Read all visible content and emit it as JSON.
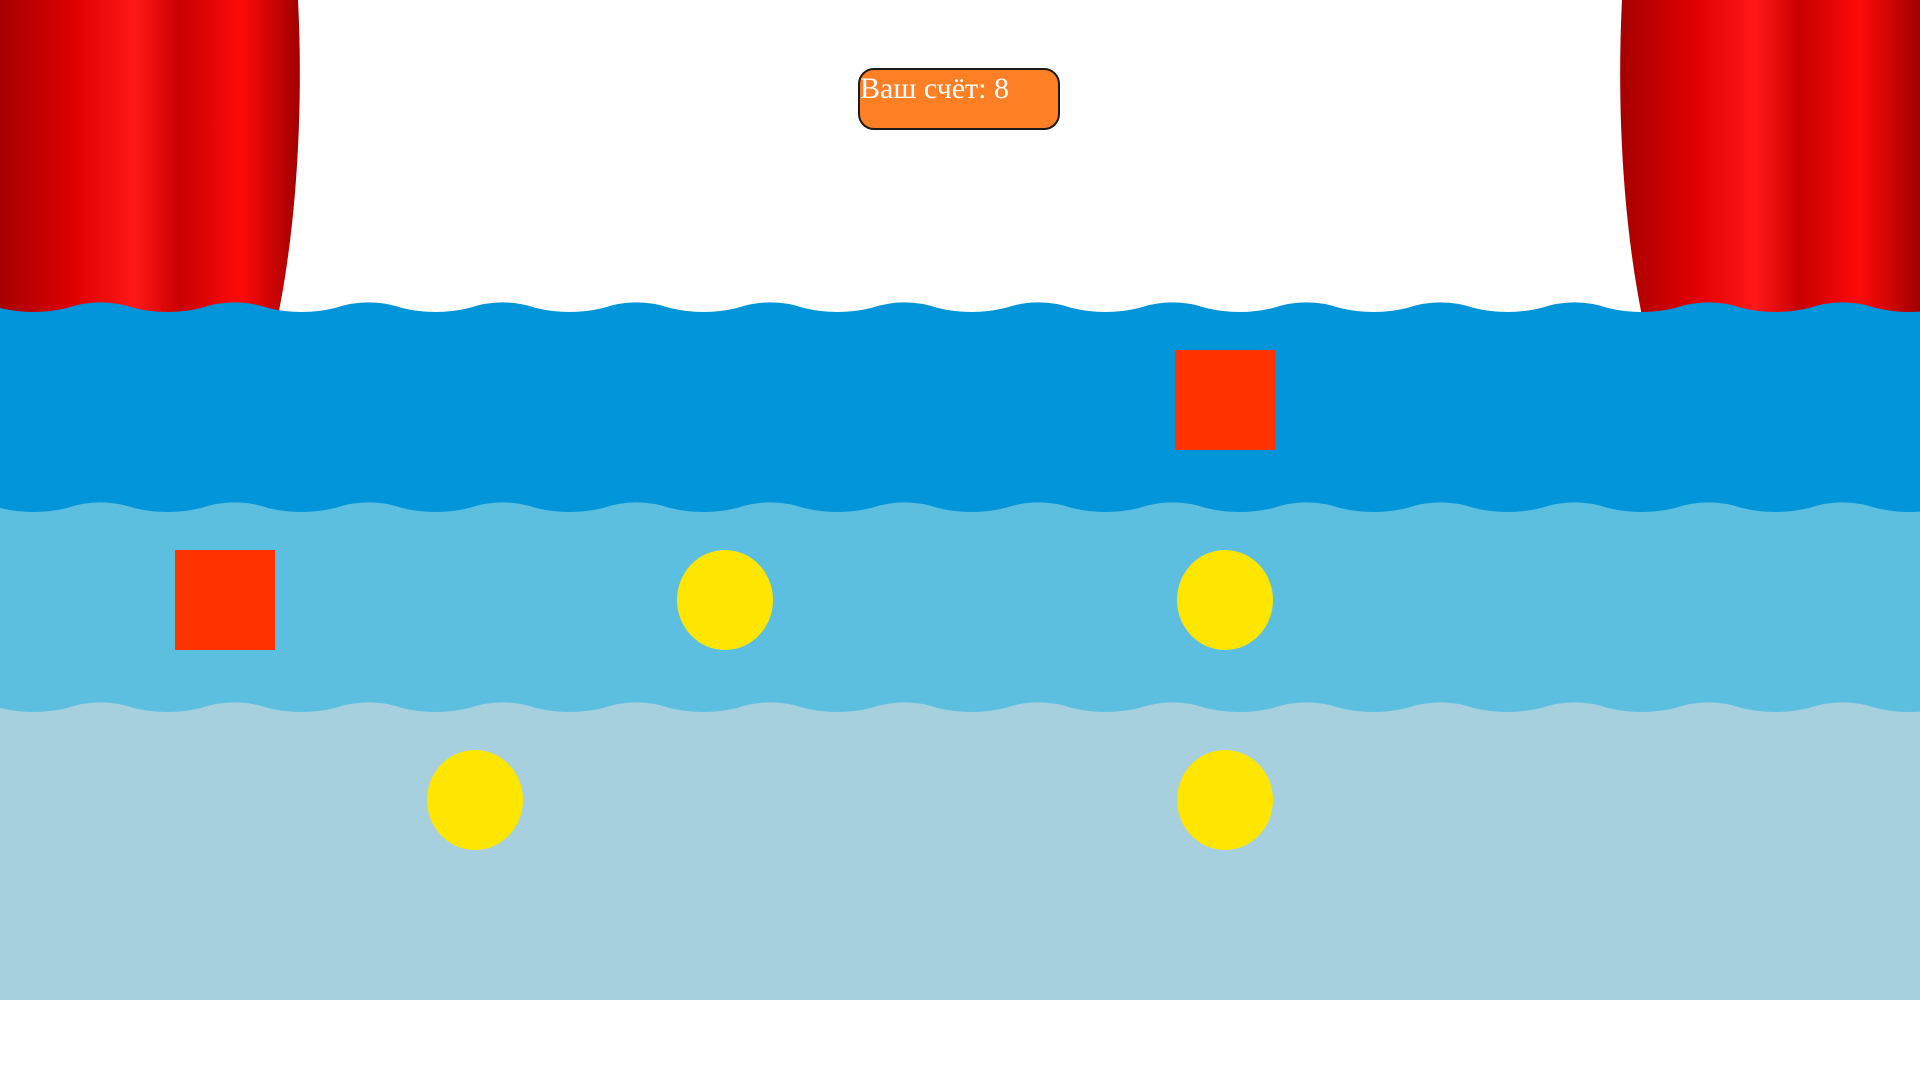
{
  "score": {
    "label": "Ваш счёт: 8",
    "background_color": "#ff7f24",
    "text_color": "#ffffff"
  },
  "colors": {
    "page_background": "#ffffff",
    "curtain_dark": "#a60000",
    "curtain_mid": "#d00000",
    "curtain_light": "#ff1010",
    "water_front": "#a7d0df",
    "water_middle": "#5cbfe0",
    "water_back": "#0295da",
    "square_target": "#ff3300",
    "circle_target": "#ffe600"
  },
  "lanes": [
    {
      "name": "back-water",
      "color": "#0295da"
    },
    {
      "name": "middle-water",
      "color": "#5cbfe0"
    },
    {
      "name": "front-water",
      "color": "#a7d0df"
    }
  ],
  "targets": [
    {
      "shape": "square",
      "lane": "back-water",
      "column": 5,
      "icon": "red-square-target"
    },
    {
      "shape": "square",
      "lane": "middle-water",
      "column": 1,
      "icon": "red-square-target"
    },
    {
      "shape": "circle",
      "lane": "middle-water",
      "column": 3,
      "icon": "yellow-circle-target"
    },
    {
      "shape": "circle",
      "lane": "middle-water",
      "column": 5,
      "icon": "yellow-circle-target"
    },
    {
      "shape": "circle",
      "lane": "front-water",
      "column": 2,
      "icon": "yellow-circle-target"
    },
    {
      "shape": "circle",
      "lane": "front-water",
      "column": 5,
      "icon": "yellow-circle-target"
    }
  ]
}
